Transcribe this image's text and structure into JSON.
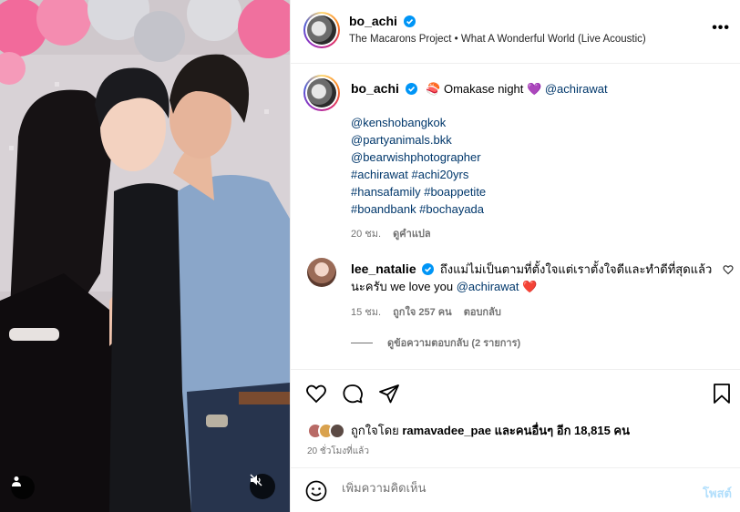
{
  "post": {
    "username": "bo_achi",
    "audio": "The Macarons Project • What A Wonderful World (Live Acoustic)",
    "more_label": "•••"
  },
  "caption": {
    "username": "bo_achi",
    "text": "🍣 Omakase night 💜",
    "mention": "@achirawat",
    "lines": [
      "@kenshobangkok",
      "@partyanimals.bkk",
      "@bearwishphotographer",
      "#achirawat #achi20yrs",
      "#hansafamily #boappetite",
      "#boandbank #bochayada"
    ],
    "time": "20 ชม.",
    "translate": "ดูคำแปล"
  },
  "comment": {
    "username": "lee_natalie",
    "text": "ถึงแม่ไม่เป็นตามที่ตั้งใจแต่เราตั้งใจดีและทำดีที่สุดแล้วนะครับ we love you ",
    "mention": "@achirawat",
    "emoji": "❤️",
    "time": "15 ชม.",
    "likes": "ถูกใจ 257 คน",
    "reply": "ตอบกลับ",
    "view_replies": "ดูข้อความตอบกลับ (2 รายการ)"
  },
  "likes": {
    "prefix": "ถูกใจโดย ",
    "user": "ramavadee_pae",
    "suffix": " และคนอื่นๆ อีก 18,815 คน"
  },
  "timestamp": "20 ชั่วโมงที่แล้ว",
  "add_comment": {
    "placeholder": "เพิ่มความคิดเห็น",
    "post_label": "โพสต์"
  },
  "colors": {
    "verified": "#0095f6",
    "link": "#00376b",
    "muted": "#737373",
    "post_disabled": "#b2dffc"
  }
}
